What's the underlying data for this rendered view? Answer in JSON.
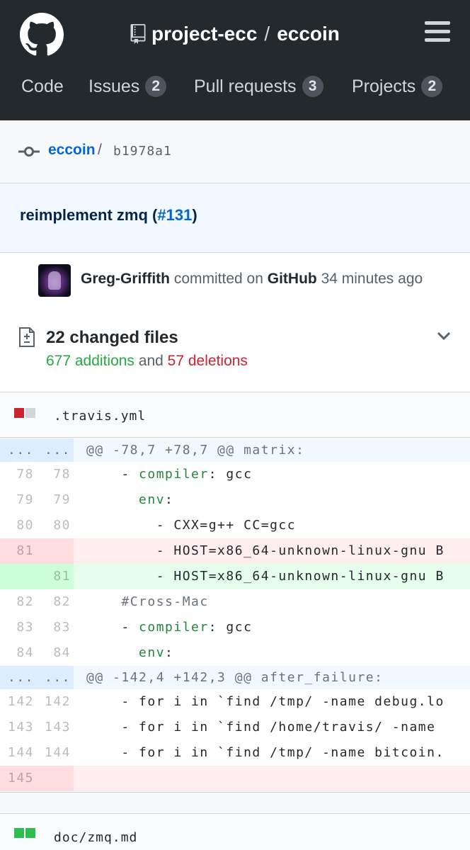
{
  "header": {
    "logo_icon": "github-octocat-icon",
    "repo_icon": "repo-book-icon",
    "owner": "project-ecc",
    "separator": "/",
    "repo": "eccoin",
    "menu_icon": "hamburger-menu-icon"
  },
  "nav": {
    "items": [
      {
        "label": "Code",
        "count": null
      },
      {
        "label": "Issues",
        "count": "2"
      },
      {
        "label": "Pull requests",
        "count": "3"
      },
      {
        "label": "Projects",
        "count": "2"
      }
    ]
  },
  "breadcrumb": {
    "icon": "git-commit-icon",
    "repo": "eccoin",
    "separator": "/",
    "sha": "b1978a1"
  },
  "commit": {
    "message": "reimplement zmq (",
    "pr_ref": "#131",
    "message_end": ")",
    "author": "Greg-Griffith",
    "committed_on": "committed on",
    "platform": "GitHub",
    "time": "34 minutes ago"
  },
  "summary": {
    "changed_files": "22 changed files",
    "additions": "677 additions",
    "and": "and",
    "deletions": "57 deletions"
  },
  "files": [
    {
      "name": ".travis.yml",
      "blocks": [
        "#cb2431",
        "#d1d5da"
      ],
      "lines": [
        {
          "type": "hunk",
          "old": "...",
          "new": "...",
          "code": "@@ -78,7 +78,7 @@ matrix:"
        },
        {
          "type": "ctx",
          "old": "78",
          "new": "78",
          "pre": "    - ",
          "key": "compiler",
          "post": ": gcc"
        },
        {
          "type": "ctx",
          "old": "79",
          "new": "79",
          "pre": "      ",
          "key": "env",
          "post": ":"
        },
        {
          "type": "ctx",
          "old": "80",
          "new": "80",
          "pre": "        - CXX=g++ CC=gcc",
          "key": "",
          "post": ""
        },
        {
          "type": "del",
          "old": "81",
          "new": "",
          "pre": "        - HOST=x86_64-unknown-linux-gnu B",
          "key": "",
          "post": ""
        },
        {
          "type": "add",
          "old": "",
          "new": "81",
          "pre": "        - HOST=x86_64-unknown-linux-gnu B",
          "key": "",
          "post": ""
        },
        {
          "type": "ctx",
          "old": "82",
          "new": "82",
          "pre": "    ",
          "com": "#Cross-Mac"
        },
        {
          "type": "ctx",
          "old": "83",
          "new": "83",
          "pre": "    - ",
          "key": "compiler",
          "post": ": gcc"
        },
        {
          "type": "ctx",
          "old": "84",
          "new": "84",
          "pre": "      ",
          "key": "env",
          "post": ":"
        },
        {
          "type": "hunk",
          "old": "...",
          "new": "...",
          "code": "@@ -142,4 +142,3 @@ after_failure:"
        },
        {
          "type": "ctx",
          "old": "142",
          "new": "142",
          "pre": "    - for i in `find /tmp/ -name debug.lo",
          "key": "",
          "post": ""
        },
        {
          "type": "ctx",
          "old": "143",
          "new": "143",
          "pre": "    - for i in `find /home/travis/ -name ",
          "key": "",
          "post": ""
        },
        {
          "type": "ctx",
          "old": "144",
          "new": "144",
          "pre": "    - for i in `find /tmp/ -name bitcoin.",
          "key": "",
          "post": ""
        },
        {
          "type": "del",
          "old": "145",
          "new": "",
          "pre": "",
          "key": "",
          "post": ""
        }
      ]
    },
    {
      "name": "doc/zmq.md",
      "blocks": [
        "#2cbe4e",
        "#2cbe4e"
      ]
    }
  ]
}
